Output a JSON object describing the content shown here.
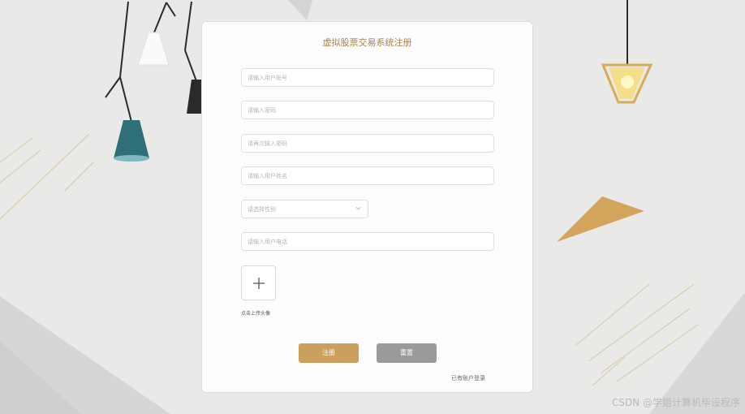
{
  "form": {
    "title": "虚拟股票交易系统注册",
    "fields": [
      {
        "placeholder": "请输入用户账号",
        "value": ""
      },
      {
        "placeholder": "请输入密码",
        "value": ""
      },
      {
        "placeholder": "请再次输入密码",
        "value": ""
      },
      {
        "placeholder": "请输入用户姓名",
        "value": ""
      },
      {
        "placeholder": "请输入用户电话",
        "value": ""
      }
    ],
    "gender_select": {
      "placeholder": "请选择性别",
      "selected": ""
    },
    "upload": {
      "label": "点击上传头像",
      "icon": "plus-icon"
    },
    "register_label": "注册",
    "reset_label": "重置",
    "login_link": "已有账户登录"
  },
  "watermark": "CSDN @学姐计算机毕设程序",
  "colors": {
    "accent": "#cc9f5d",
    "title": "#a8834a",
    "reset": "#9a9a9a",
    "background": "#e9e9e7"
  }
}
